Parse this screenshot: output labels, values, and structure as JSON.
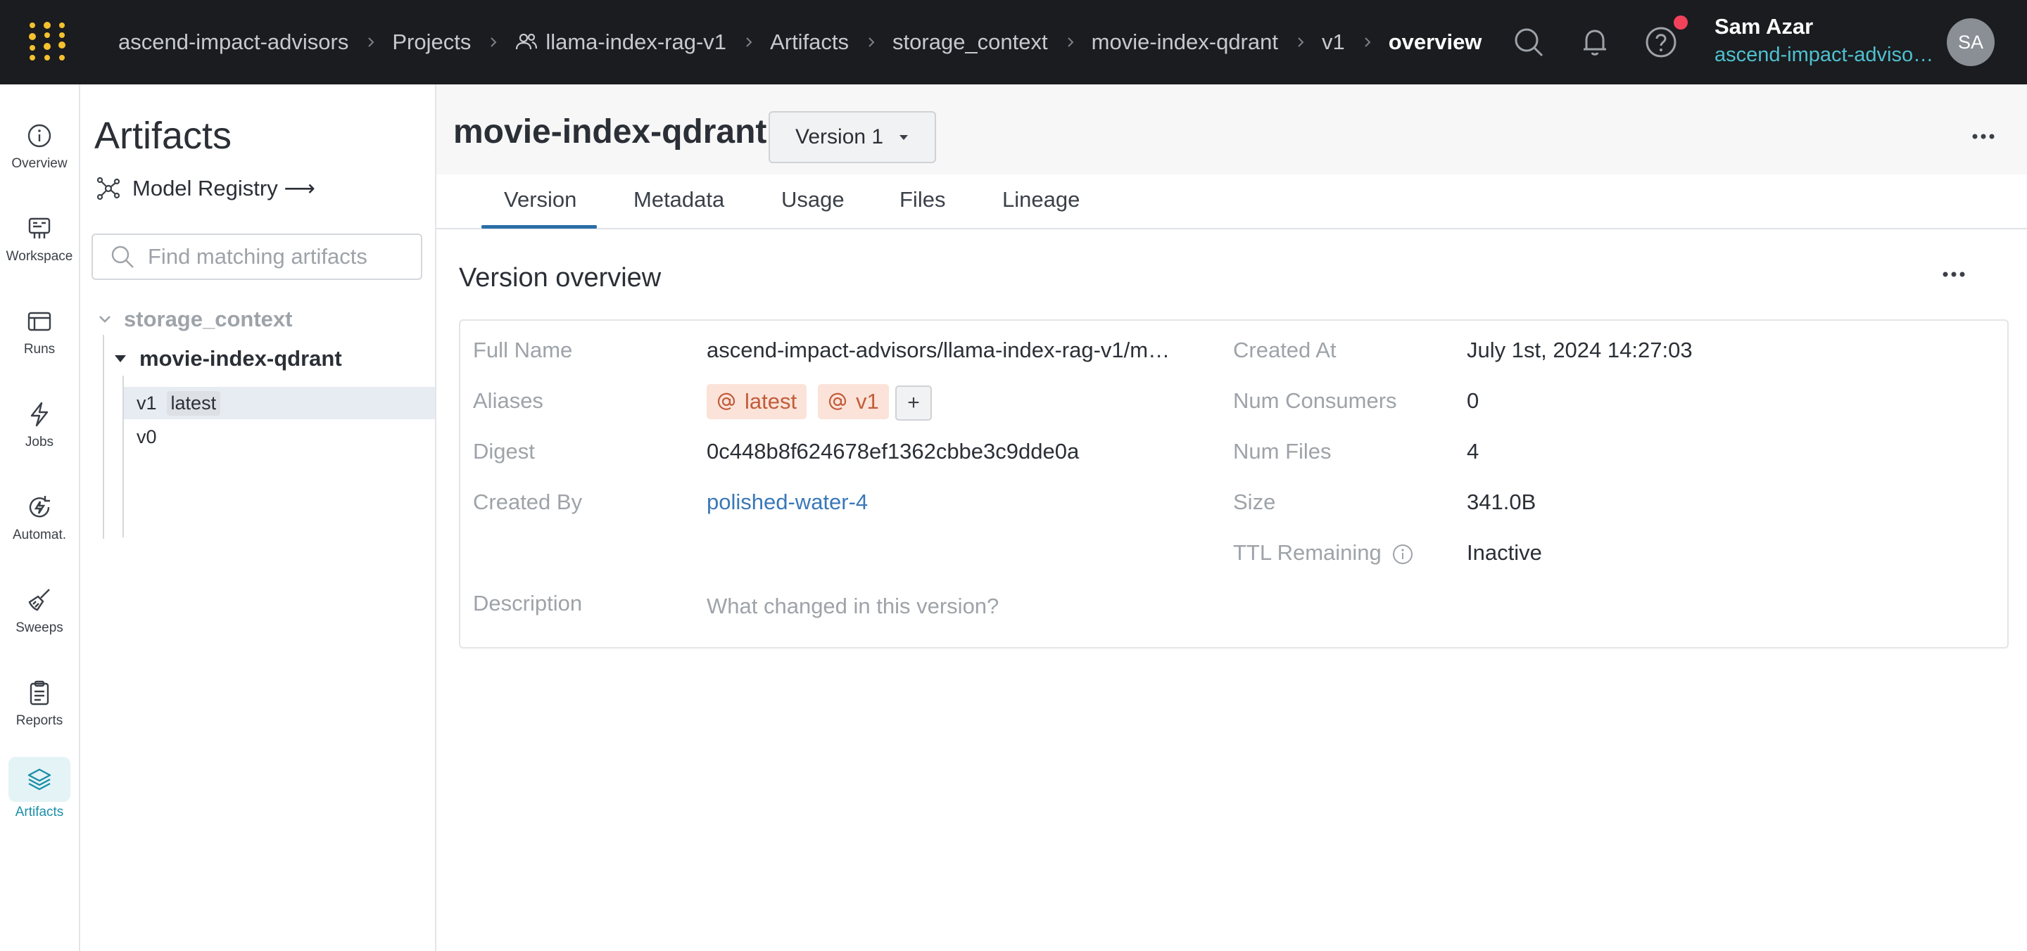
{
  "topbar": {
    "breadcrumbs": [
      {
        "label": "ascend-impact-advisors"
      },
      {
        "label": "Projects"
      },
      {
        "label": "llama-index-rag-v1",
        "icon": "team-icon"
      },
      {
        "label": "Artifacts"
      },
      {
        "label": "storage_context"
      },
      {
        "label": "movie-index-qdrant"
      },
      {
        "label": "v1"
      },
      {
        "label": "overview"
      }
    ],
    "icons": [
      "search-icon",
      "bell-icon",
      "help-icon"
    ],
    "notification_dot_color": "#f2425b",
    "user": {
      "name": "Sam Azar",
      "org": "ascend-impact-adviso…",
      "initials": "SA"
    }
  },
  "leftnav": {
    "items": [
      {
        "label": "Overview",
        "icon": "info-icon"
      },
      {
        "label": "Workspace",
        "icon": "workspace-icon"
      },
      {
        "label": "Runs",
        "icon": "runs-table-icon"
      },
      {
        "label": "Jobs",
        "icon": "lightning-icon"
      },
      {
        "label": "Automat.",
        "icon": "automation-icon"
      },
      {
        "label": "Sweeps",
        "icon": "broom-icon"
      },
      {
        "label": "Reports",
        "icon": "clipboard-icon"
      },
      {
        "label": "Artifacts",
        "icon": "layers-icon",
        "active": true
      }
    ],
    "accent_color": "#1a8ea8"
  },
  "sidebar": {
    "title": "Artifacts",
    "registry_link": "Model Registry ⟶",
    "search_placeholder": "Find matching artifacts",
    "tree": {
      "type_name": "storage_context",
      "collection_name": "movie-index-qdrant",
      "versions": [
        {
          "version": "v1",
          "tag": "latest",
          "selected": true
        },
        {
          "version": "v0",
          "tag": "",
          "selected": false
        }
      ]
    }
  },
  "main": {
    "title": "movie-index-qdrant",
    "version_select": "Version 1",
    "tabs": [
      "Version",
      "Metadata",
      "Usage",
      "Files",
      "Lineage"
    ],
    "active_tab": "Version",
    "overview": {
      "title": "Version overview",
      "left_fields": {
        "full_name_label": "Full Name",
        "full_name_value": "ascend-impact-advisors/llama-index-rag-v1/m…",
        "aliases_label": "Aliases",
        "aliases": [
          "latest",
          "v1"
        ],
        "add_alias": "+",
        "digest_label": "Digest",
        "digest_value": "0c448b8f624678ef1362cbbe3c9dde0a",
        "created_by_label": "Created By",
        "created_by_value": "polished-water-4",
        "description_label": "Description",
        "description_placeholder": "What changed in this version?"
      },
      "right_fields": {
        "created_at_label": "Created At",
        "created_at_value": "July 1st, 2024 14:27:03",
        "num_consumers_label": "Num Consumers",
        "num_consumers_value": "0",
        "num_files_label": "Num Files",
        "num_files_value": "4",
        "size_label": "Size",
        "size_value": "341.0B",
        "ttl_label": "TTL Remaining",
        "ttl_value": "Inactive"
      }
    },
    "link_color": "#3a78b8",
    "alias_color": "#c25c3a"
  }
}
